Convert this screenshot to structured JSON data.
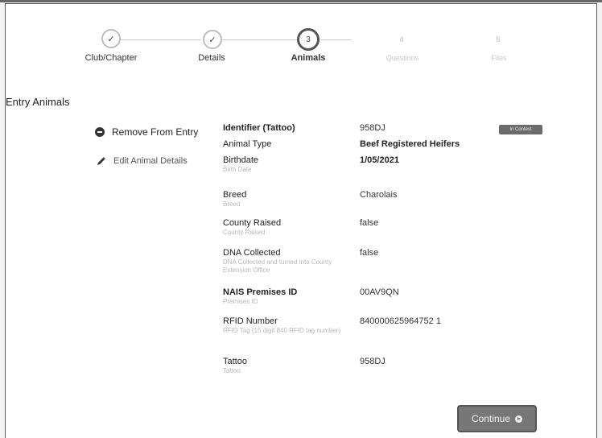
{
  "stepper": {
    "steps": [
      {
        "label": "Club/Chapter",
        "marker": "✓",
        "state": "done"
      },
      {
        "label": "Details",
        "marker": "✓",
        "state": "done"
      },
      {
        "label": "Animals",
        "marker": "3",
        "state": "active"
      },
      {
        "label": "Questions",
        "marker": "4",
        "state": "todo"
      },
      {
        "label": "Files",
        "marker": "5",
        "state": "todo"
      }
    ]
  },
  "section": {
    "title": "Entry Animals"
  },
  "actions": {
    "remove_label": "Remove From Entry",
    "edit_label": "Edit Animal Details"
  },
  "animal": {
    "badge": "In Contest",
    "fields": [
      {
        "label": "Identifier (Tattoo)",
        "sub": "",
        "value": "958DJ"
      },
      {
        "label": "Animal Type",
        "sub": "",
        "value": "Beef Registered Heifers"
      },
      {
        "label": "Birthdate",
        "sub": "Birth Date",
        "value": "1/05/2021"
      },
      {
        "label": "Breed",
        "sub": "Breed",
        "value": "Charolais"
      },
      {
        "label": "County Raised",
        "sub": "County Raised",
        "value": "false"
      },
      {
        "label": "DNA Collected",
        "sub": "DNA Collected and turned into County Extension Office",
        "value": "false"
      },
      {
        "label": "NAIS Premises ID",
        "sub": "Premises ID",
        "value": "00AV9QN"
      },
      {
        "label": "RFID Number",
        "sub": "RFID Tag (15 digit 840 RFID tag number)",
        "value": "840000625964752 1"
      },
      {
        "label": "Tattoo",
        "sub": "Tattoo",
        "value": "958DJ"
      }
    ]
  },
  "footer": {
    "continue_label": "Continue"
  }
}
